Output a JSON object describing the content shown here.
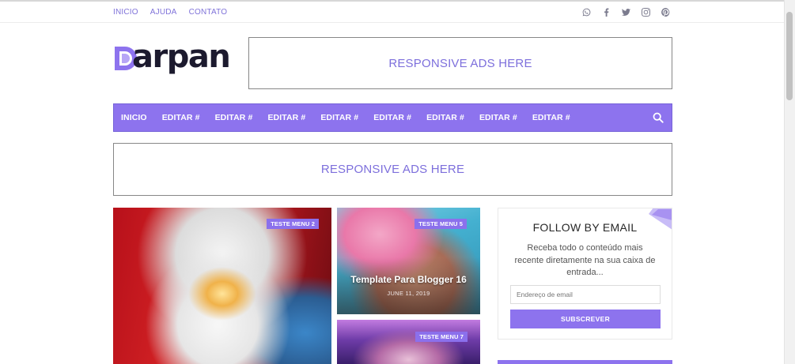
{
  "top_nav": {
    "links": [
      "INICIO",
      "AJUDA",
      "CONTATO"
    ]
  },
  "social_icons": [
    "whatsapp-icon",
    "facebook-icon",
    "twitter-icon",
    "instagram-icon",
    "pinterest-icon"
  ],
  "logo": {
    "text": "arpan",
    "mark_letter": "D"
  },
  "ads": {
    "top_label": "RESPONSIVE ADS HERE",
    "mid_label": "RESPONSIVE ADS HERE"
  },
  "main_nav": {
    "items": [
      "INICIO",
      "EDITAR #",
      "EDITAR #",
      "EDITAR #",
      "EDITAR #",
      "EDITAR #",
      "EDITAR #",
      "EDITAR #",
      "EDITAR #"
    ],
    "search_icon": "search-icon"
  },
  "posts": [
    {
      "tag": "TESTE MENU 2"
    },
    {
      "tag": "TESTE MENU 5",
      "title": "Template Para Blogger 16",
      "date": "JUNE 11, 2019"
    },
    {
      "tag": "TESTE MENU 7"
    }
  ],
  "follow_widget": {
    "title": "FOLLOW BY EMAIL",
    "description": "Receba todo o conteúdo mais recente diretamente na sua caixa de entrada...",
    "email_placeholder": "Endereço de email",
    "button_label": "SUBSCREVER"
  },
  "colors": {
    "accent": "#8d73ee",
    "accent_text": "#7d6fdc"
  }
}
